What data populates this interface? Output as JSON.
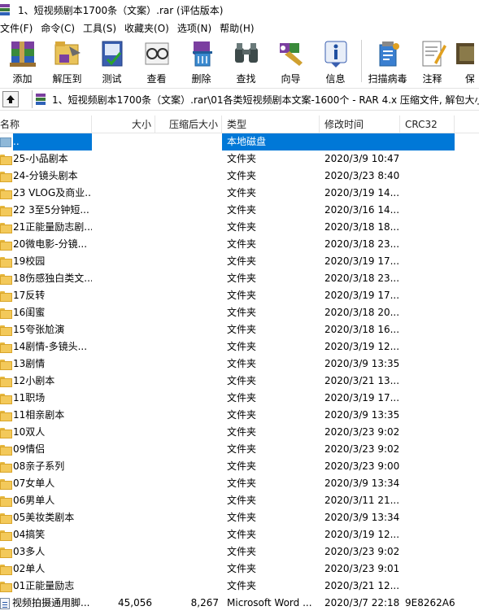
{
  "window": {
    "title": "1、短视频剧本1700条（文案）.rar (评估版本)"
  },
  "menu": [
    "文件(F)",
    "命令(C)",
    "工具(S)",
    "收藏夹(O)",
    "选项(N)",
    "帮助(H)"
  ],
  "toolbar": [
    {
      "label": "添加",
      "icon": "add-archive-icon"
    },
    {
      "label": "解压到",
      "icon": "extract-to-icon"
    },
    {
      "label": "测试",
      "icon": "test-icon"
    },
    {
      "label": "查看",
      "icon": "view-icon"
    },
    {
      "label": "删除",
      "icon": "delete-icon"
    },
    {
      "label": "查找",
      "icon": "find-icon"
    },
    {
      "label": "向导",
      "icon": "wizard-icon"
    },
    {
      "label": "信息",
      "icon": "info-icon"
    },
    {
      "label": "扫描病毒",
      "icon": "virus-scan-icon"
    },
    {
      "label": "注释",
      "icon": "comment-icon"
    },
    {
      "label": "保",
      "icon": "protect-icon"
    }
  ],
  "address": {
    "path": "1、短视频剧本1700条（文案）.rar\\01各类短视频剧本文案-1600个 - RAR 4.x 压缩文件, 解包大小"
  },
  "columns": {
    "name": "名称",
    "size": "大小",
    "packed": "压缩后大小",
    "type": "类型",
    "mtime": "修改时间",
    "crc": "CRC32"
  },
  "colors": {
    "selection": "#0078d7",
    "folder": "#f3c95a"
  },
  "rows": [
    {
      "name": "..",
      "size": "",
      "packed": "",
      "type": "本地磁盘",
      "mtime": "",
      "crc": "",
      "kind": "up",
      "selected": true
    },
    {
      "name": "25-小品剧本",
      "size": "",
      "packed": "",
      "type": "文件夹",
      "mtime": "2020/3/9 10:47",
      "crc": "",
      "kind": "folder"
    },
    {
      "name": "24-分镜头剧本",
      "size": "",
      "packed": "",
      "type": "文件夹",
      "mtime": "2020/3/23 8:40",
      "crc": "",
      "kind": "folder"
    },
    {
      "name": "23 VLOG及商业...",
      "size": "",
      "packed": "",
      "type": "文件夹",
      "mtime": "2020/3/19 14...",
      "crc": "",
      "kind": "folder"
    },
    {
      "name": "22 3至5分钟短...",
      "size": "",
      "packed": "",
      "type": "文件夹",
      "mtime": "2020/3/16 14...",
      "crc": "",
      "kind": "folder"
    },
    {
      "name": "21正能量励志剧...",
      "size": "",
      "packed": "",
      "type": "文件夹",
      "mtime": "2020/3/18 18...",
      "crc": "",
      "kind": "folder"
    },
    {
      "name": "20微电影-分镜...",
      "size": "",
      "packed": "",
      "type": "文件夹",
      "mtime": "2020/3/18 23...",
      "crc": "",
      "kind": "folder"
    },
    {
      "name": "19校园",
      "size": "",
      "packed": "",
      "type": "文件夹",
      "mtime": "2020/3/19 17...",
      "crc": "",
      "kind": "folder"
    },
    {
      "name": "18伤感独白类文...",
      "size": "",
      "packed": "",
      "type": "文件夹",
      "mtime": "2020/3/18 23...",
      "crc": "",
      "kind": "folder"
    },
    {
      "name": "17反转",
      "size": "",
      "packed": "",
      "type": "文件夹",
      "mtime": "2020/3/19 17...",
      "crc": "",
      "kind": "folder"
    },
    {
      "name": "16闺蜜",
      "size": "",
      "packed": "",
      "type": "文件夹",
      "mtime": "2020/3/18 20...",
      "crc": "",
      "kind": "folder"
    },
    {
      "name": "15夸张尬演",
      "size": "",
      "packed": "",
      "type": "文件夹",
      "mtime": "2020/3/18 16...",
      "crc": "",
      "kind": "folder"
    },
    {
      "name": "14剧情-多镜头...",
      "size": "",
      "packed": "",
      "type": "文件夹",
      "mtime": "2020/3/19 12...",
      "crc": "",
      "kind": "folder"
    },
    {
      "name": "13剧情",
      "size": "",
      "packed": "",
      "type": "文件夹",
      "mtime": "2020/3/9 13:35",
      "crc": "",
      "kind": "folder"
    },
    {
      "name": "12小剧本",
      "size": "",
      "packed": "",
      "type": "文件夹",
      "mtime": "2020/3/21 13...",
      "crc": "",
      "kind": "folder"
    },
    {
      "name": "11职场",
      "size": "",
      "packed": "",
      "type": "文件夹",
      "mtime": "2020/3/19 17...",
      "crc": "",
      "kind": "folder"
    },
    {
      "name": "11相亲剧本",
      "size": "",
      "packed": "",
      "type": "文件夹",
      "mtime": "2020/3/9 13:35",
      "crc": "",
      "kind": "folder"
    },
    {
      "name": "10双人",
      "size": "",
      "packed": "",
      "type": "文件夹",
      "mtime": "2020/3/23 9:02",
      "crc": "",
      "kind": "folder"
    },
    {
      "name": "09情侣",
      "size": "",
      "packed": "",
      "type": "文件夹",
      "mtime": "2020/3/23 9:02",
      "crc": "",
      "kind": "folder"
    },
    {
      "name": "08亲子系列",
      "size": "",
      "packed": "",
      "type": "文件夹",
      "mtime": "2020/3/23 9:00",
      "crc": "",
      "kind": "folder"
    },
    {
      "name": "07女单人",
      "size": "",
      "packed": "",
      "type": "文件夹",
      "mtime": "2020/3/9 13:34",
      "crc": "",
      "kind": "folder"
    },
    {
      "name": "06男单人",
      "size": "",
      "packed": "",
      "type": "文件夹",
      "mtime": "2020/3/11 21...",
      "crc": "",
      "kind": "folder"
    },
    {
      "name": "05美妆类剧本",
      "size": "",
      "packed": "",
      "type": "文件夹",
      "mtime": "2020/3/9 13:34",
      "crc": "",
      "kind": "folder"
    },
    {
      "name": "04搞笑",
      "size": "",
      "packed": "",
      "type": "文件夹",
      "mtime": "2020/3/19 12...",
      "crc": "",
      "kind": "folder"
    },
    {
      "name": "03多人",
      "size": "",
      "packed": "",
      "type": "文件夹",
      "mtime": "2020/3/23 9:02",
      "crc": "",
      "kind": "folder"
    },
    {
      "name": "02单人",
      "size": "",
      "packed": "",
      "type": "文件夹",
      "mtime": "2020/3/23 9:01",
      "crc": "",
      "kind": "folder"
    },
    {
      "name": "01正能量励志",
      "size": "",
      "packed": "",
      "type": "文件夹",
      "mtime": "2020/3/21 12...",
      "crc": "",
      "kind": "folder"
    },
    {
      "name": "视频拍摄通用脚...",
      "size": "45,056",
      "packed": "8,267",
      "type": "Microsoft Word ...",
      "mtime": "2020/3/7 22:18",
      "crc": "9E8262A6",
      "kind": "doc"
    }
  ]
}
